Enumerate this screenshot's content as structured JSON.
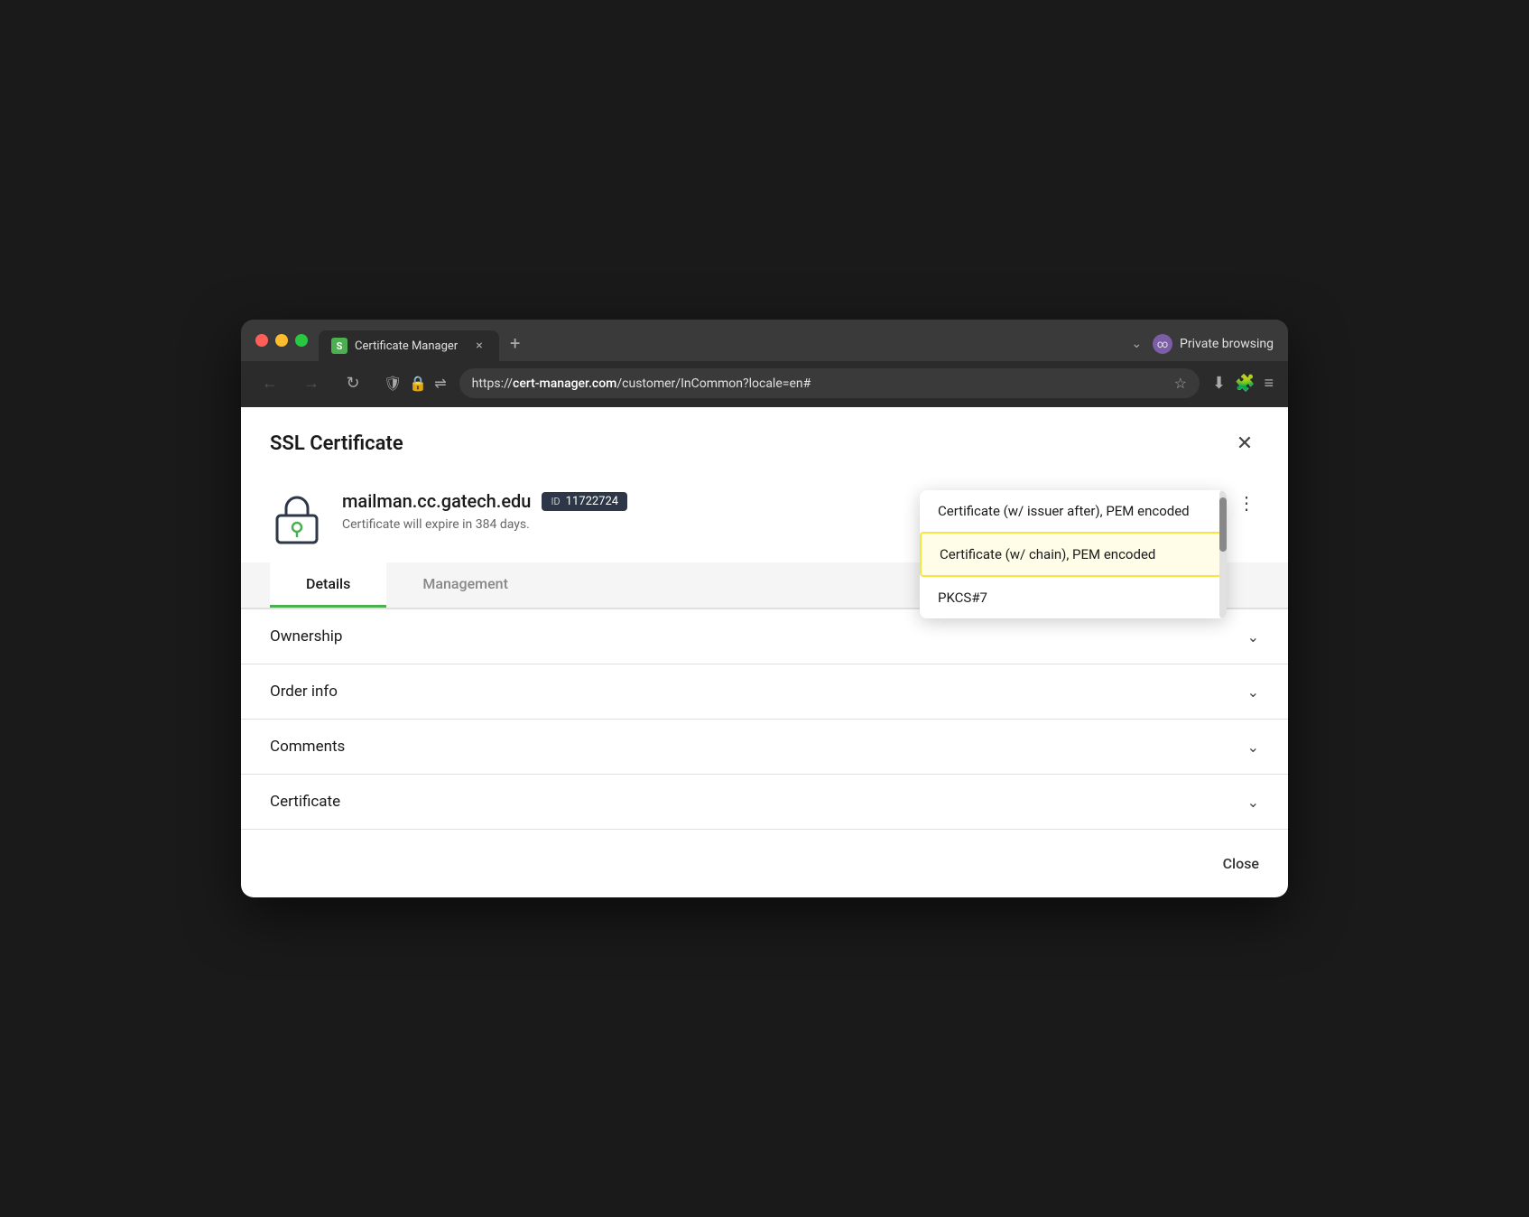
{
  "browser": {
    "tab": {
      "favicon_text": "S",
      "title": "Certificate Manager",
      "close_label": "×"
    },
    "new_tab_label": "+",
    "chevron_label": "⌄",
    "private_browsing": {
      "label": "Private browsing",
      "icon": "∞"
    },
    "nav": {
      "back_label": "←",
      "forward_label": "→",
      "reload_label": "↻",
      "shield_label": "🛡",
      "lock_label": "🔒",
      "network_label": "⇌",
      "url_display": "https://cert-manager.com/customer/InCommon?locale=en#",
      "url_prefix": "https://",
      "url_domain": "cert-manager.com",
      "url_suffix": "/customer/InCommon?locale=en#",
      "star_label": "☆",
      "download_label": "⬇",
      "extensions_label": "🧩",
      "menu_label": "≡"
    }
  },
  "modal": {
    "title": "SSL Certificate",
    "close_label": "✕",
    "cert": {
      "domain": "mailman.cc.gatech.edu",
      "id_label": "ID",
      "id_value": "11722724",
      "expiry": "Certificate will expire in 384 days."
    },
    "dropdown": {
      "items": [
        {
          "label": "Certificate (w/ issuer after), PEM encoded",
          "selected": false
        },
        {
          "label": "Certificate (w/ chain), PEM encoded",
          "selected": true
        },
        {
          "label": "PKCS#7",
          "selected": false
        }
      ]
    },
    "more_icon": "⋮",
    "tabs": [
      {
        "label": "Details",
        "active": true
      },
      {
        "label": "Management",
        "active": false
      }
    ],
    "sections": [
      {
        "label": "Ownership"
      },
      {
        "label": "Order info"
      },
      {
        "label": "Comments"
      },
      {
        "label": "Certificate"
      }
    ],
    "footer": {
      "close_label": "Close"
    }
  }
}
